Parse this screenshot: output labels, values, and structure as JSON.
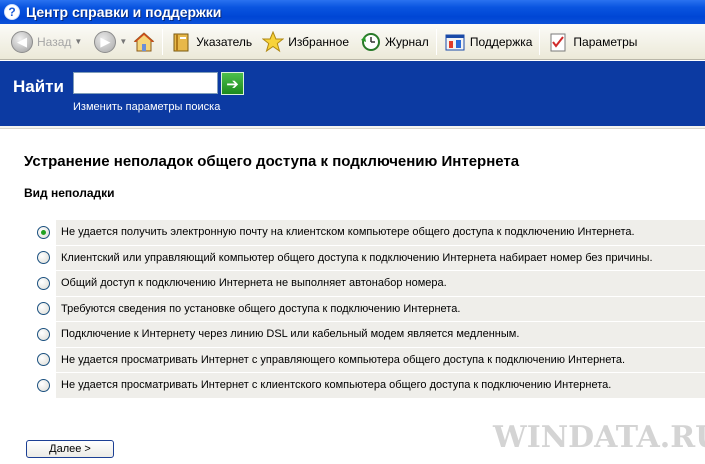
{
  "window": {
    "title": "Центр справки и поддержки",
    "app_icon": "?"
  },
  "toolbar": {
    "back_label": "Назад",
    "index_label": "Указатель",
    "favorites_label": "Избранное",
    "history_label": "Журнал",
    "support_label": "Поддержка",
    "options_label": "Параметры",
    "icons": [
      "back-arrow-icon",
      "forward-arrow-icon",
      "home-icon",
      "index-book-icon",
      "favorites-star-icon",
      "history-icon",
      "support-icon",
      "options-icon"
    ]
  },
  "search": {
    "label": "Найти",
    "value": "",
    "go_symbol": "➔",
    "options_link": "Изменить параметры поиска"
  },
  "content": {
    "title": "Устранение неполадок общего доступа к подключению Интернета",
    "section_title": "Вид неполадки",
    "options": [
      {
        "label": "Не удается получить электронную почту на клиентском компьютере общего доступа к подключению Интернета.",
        "checked": true
      },
      {
        "label": "Клиентский или управляющий компьютер общего доступа к подключению Интернета набирает номер без причины.",
        "checked": false
      },
      {
        "label": "Общий доступ к подключению Интернета не выполняет автонабор номера.",
        "checked": false
      },
      {
        "label": "Требуются сведения по установке общего доступа к подключению Интернета.",
        "checked": false
      },
      {
        "label": "Подключение к Интернету через линию DSL или кабельный модем является медленным.",
        "checked": false
      },
      {
        "label": "Не удается просматривать Интернет с управляющего компьютера общего доступа к подключению Интернета.",
        "checked": false
      },
      {
        "label": "Не удается просматривать Интернет с клиентского компьютера общего доступа к подключению Интернета.",
        "checked": false
      }
    ],
    "next_button": "Далее  >"
  },
  "watermark": "WINDATA.RU",
  "colors": {
    "search_band": "#0c3aa2",
    "option_bg": "#efeeea",
    "radio_checked": "#21a121"
  }
}
